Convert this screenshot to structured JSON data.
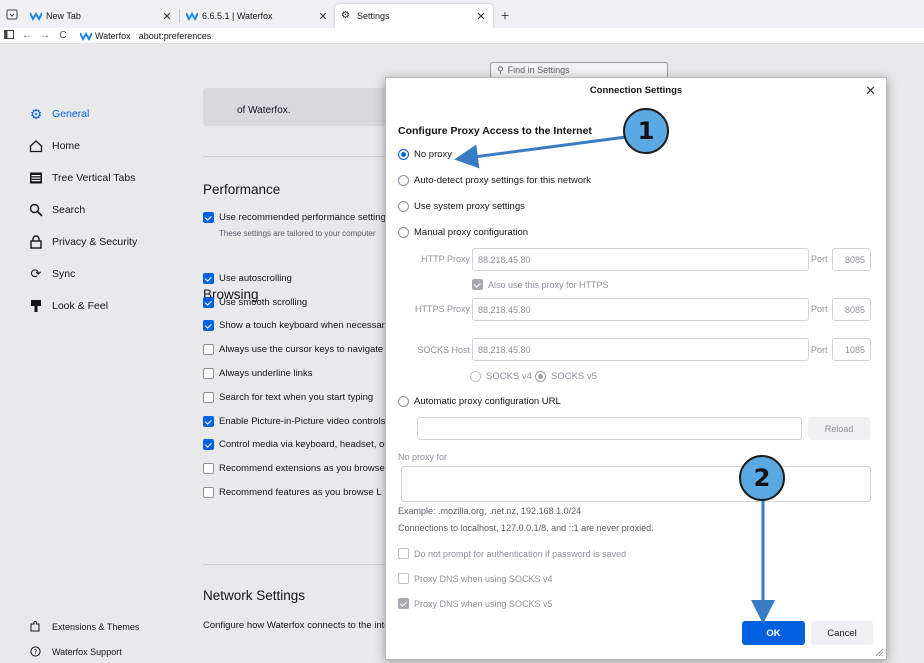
{
  "colors": {
    "accent": "#0061e0",
    "annotation": "#3a7cc4",
    "marker_fill": "#5aa9e2",
    "page_bg": "#e9e9ec"
  },
  "tabs": [
    {
      "label": "New Tab",
      "icon": "waterfox-icon"
    },
    {
      "label": "6.6.5.1 | Waterfox",
      "icon": "waterfox-icon"
    },
    {
      "label": "Settings",
      "icon": "gear-icon",
      "active": true
    }
  ],
  "urlbar": {
    "identity": "Waterfox",
    "url": "about:preferences"
  },
  "find": {
    "placeholder": "Find in Settings"
  },
  "sidebar": {
    "items": [
      {
        "label": "General",
        "icon": "gear-icon",
        "selected": true
      },
      {
        "label": "Home",
        "icon": "home-icon"
      },
      {
        "label": "Tree Vertical Tabs",
        "icon": "tabs-icon"
      },
      {
        "label": "Search",
        "icon": "search-icon"
      },
      {
        "label": "Privacy & Security",
        "icon": "lock-icon"
      },
      {
        "label": "Sync",
        "icon": "sync-icon"
      },
      {
        "label": "Look & Feel",
        "icon": "brush-icon"
      }
    ],
    "extensions": "Extensions & Themes",
    "support": "Waterfox Support"
  },
  "main": {
    "notice_text": "of Waterfox.",
    "performance": {
      "heading": "Performance",
      "option": "Use recommended performance settings",
      "note": "These settings are tailored to your computer"
    },
    "browsing": {
      "heading": "Browsing",
      "options": [
        {
          "label": "Use autoscrolling",
          "checked": true
        },
        {
          "label": "Use smooth scrolling",
          "checked": true
        },
        {
          "label": "Show a touch keyboard when necessary",
          "checked": true
        },
        {
          "label": "Always use the cursor keys to navigate within pages",
          "checked": false
        },
        {
          "label": "Always underline links",
          "checked": false
        },
        {
          "label": "Search for text when you start typing",
          "checked": false
        },
        {
          "label": "Enable Picture-in-Picture video controls",
          "checked": true
        },
        {
          "label": "Control media via keyboard, headset, or virtual interface",
          "checked": true
        },
        {
          "label": "Recommend extensions as you browse",
          "checked": false
        },
        {
          "label": "Recommend features as you browse L",
          "checked": false
        }
      ]
    },
    "network": {
      "heading": "Network Settings",
      "description": "Configure how Waterfox connects to the internet."
    }
  },
  "dialog": {
    "title": "Connection Settings",
    "heading": "Configure Proxy Access to the Internet",
    "radios": {
      "no_proxy": "No proxy",
      "auto_detect": "Auto-detect proxy settings for this network",
      "system": "Use system proxy settings",
      "manual": "Manual proxy configuration",
      "auto_url": "Automatic proxy configuration URL"
    },
    "selected": "no_proxy",
    "http": {
      "label": "HTTP Proxy",
      "value": "88.218.45.80",
      "port_label": "Port",
      "port": "8085"
    },
    "also_https": "Also use this proxy for HTTPS",
    "https": {
      "label": "HTTPS Proxy",
      "value": "88.218.45.80",
      "port_label": "Port",
      "port": "8085"
    },
    "socks": {
      "label": "SOCKS Host",
      "value": "88.218.45.80",
      "port_label": "Port",
      "port": "1085"
    },
    "socks_v4": "SOCKS v4",
    "socks_v5": "SOCKS v5",
    "reload": "Reload",
    "no_proxy_for": "No proxy for",
    "example": "Example: .mozilla.org, .net.nz, 192.168.1.0/24",
    "localhost_note": "Connections to localhost, 127.0.0.1/8, and ::1 are never proxied.",
    "no_prompt_auth": "Do not prompt for authentication if password is saved",
    "dns_v4": "Proxy DNS when using SOCKS v4",
    "dns_v5": "Proxy DNS when using SOCKS v5",
    "ok": "OK",
    "cancel": "Cancel"
  },
  "annotations": {
    "marker_1": "1",
    "marker_2": "2"
  }
}
